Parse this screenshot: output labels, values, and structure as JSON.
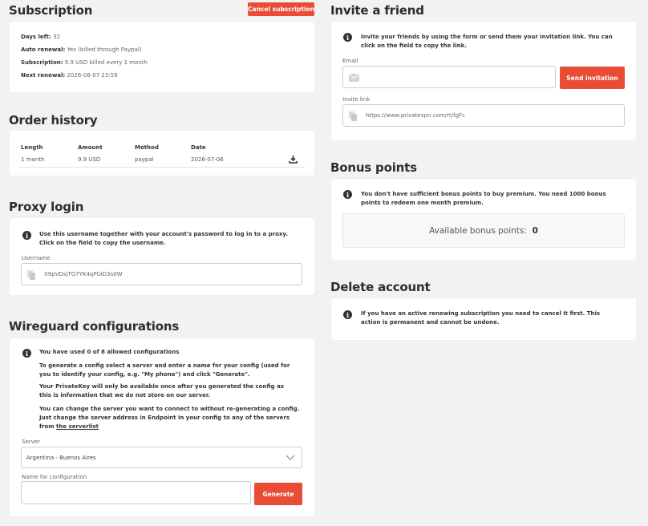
{
  "subscription": {
    "title": "Subscription",
    "cancel_label": "Cancel subscription",
    "rows": [
      {
        "label": "Days left:",
        "value": "32"
      },
      {
        "label": "Auto renewal:",
        "value": "Yes (billed through Paypal)"
      },
      {
        "label": "Subscription:",
        "value": "9.9 USD billed every 1 month"
      },
      {
        "label": "Next renewal:",
        "value": "2026-08-07 23:59"
      }
    ]
  },
  "order_history": {
    "title": "Order history",
    "headers": [
      "Length",
      "Amount",
      "Method",
      "Date"
    ],
    "rows": [
      [
        "1 month",
        "9.9 USD",
        "paypal",
        "2026-07-06"
      ]
    ]
  },
  "proxy": {
    "title": "Proxy login",
    "info": "Use this username together with your account's password to log in to a proxy. Click on the field to copy the username.",
    "username_label": "Username",
    "username_value": "X9pVDsjTG7YK4qPUiD3s0W"
  },
  "wireguard": {
    "title": "Wireguard configurations",
    "used": "You have used 0 of 8 allowed configurations",
    "p1": "To generate a config select a server and enter a name for your config (used for you to identify your config, e.g. \"My phone\") and click \"Generate\".",
    "p2": "Your PrivateKey will only be available once after you generated the config as this is information that we do not store on our server.",
    "p3": "You can change the server you want to connect to without re-generating a config. Just change the server address in Endpoint in your config to any of the servers from",
    "p3_link": "the serverlist",
    "server_label": "Server",
    "server_value": "Argentina - Buenos Aires",
    "name_label": "Name for configuration",
    "name_value": "",
    "generate_label": "Generate"
  },
  "invite": {
    "title": "Invite a friend",
    "info": "Invite your friends by using the form or send them your invitation link. You can click on the field to copy the link.",
    "email_label": "Email",
    "email_value": "",
    "send_label": "Send invitation",
    "link_label": "Invite link",
    "link_value": "https://www.privatevpn.com/rt/fgFc"
  },
  "bonus": {
    "title": "Bonus points",
    "info": "You don't have sufficient bonus points to buy premium. You need 1000 bonus points to redeem one month premium.",
    "available_label": "Available bonus points:",
    "available_value": "0"
  },
  "delete": {
    "title": "Delete account",
    "info": "If you have an active renewing subscription you need to cancel it first. This action is permanent and cannot be undone."
  },
  "colors": {
    "accent": "#e94b35",
    "background": "#f2f2f2",
    "card": "#ffffff"
  },
  "icons": [
    "info-icon",
    "copy-icon",
    "mail-icon",
    "download-icon",
    "chevron-down-icon"
  ]
}
